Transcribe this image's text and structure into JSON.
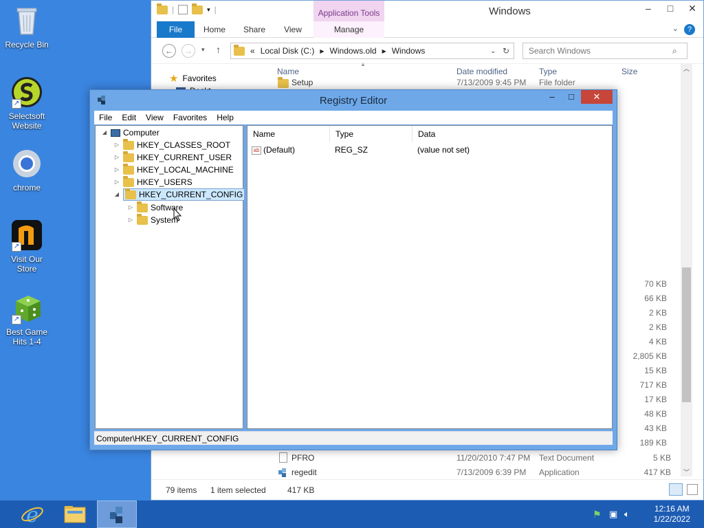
{
  "desktop": {
    "icons": [
      {
        "label": "Recycle Bin"
      },
      {
        "label": "Selectsoft Website"
      },
      {
        "label": "chrome"
      },
      {
        "label": "Visit Our Store"
      },
      {
        "label": "Best Game Hits 1-4"
      }
    ]
  },
  "explorer": {
    "title": "Windows",
    "app_tools_label": "Application Tools",
    "tabs": [
      "File",
      "Home",
      "Share",
      "View",
      "Manage"
    ],
    "address": {
      "prefix": "«",
      "parts": [
        "Local Disk (C:)",
        "Windows.old",
        "Windows"
      ]
    },
    "search_placeholder": "Search Windows",
    "nav_pane": {
      "favorites": "Favorites",
      "partial_item": "Deskt"
    },
    "columns": {
      "name": "Name",
      "date": "Date modified",
      "type": "Type",
      "size": "Size"
    },
    "top_row": {
      "name": "Setup",
      "date": "7/13/2009 9:45 PM",
      "type": "File folder"
    },
    "sizes": [
      "70 KB",
      "66 KB",
      "2 KB",
      "2 KB",
      "4 KB",
      "2,805 KB",
      "15 KB",
      "717 KB",
      "17 KB",
      "48 KB",
      "43 KB",
      "189 KB"
    ],
    "rows": [
      {
        "name": "PFRO",
        "date": "11/20/2010 7:47 PM",
        "type": "Text Document",
        "size": "5 KB"
      },
      {
        "name": "regedit",
        "date": "7/13/2009 6:39 PM",
        "type": "Application",
        "size": "417 KB"
      }
    ],
    "status": {
      "items": "79 items",
      "selected": "1 item selected",
      "size": "417 KB"
    }
  },
  "regedit": {
    "title": "Registry Editor",
    "menu": [
      "File",
      "Edit",
      "View",
      "Favorites",
      "Help"
    ],
    "tree": {
      "root": "Computer",
      "hives": [
        "HKEY_CLASSES_ROOT",
        "HKEY_CURRENT_USER",
        "HKEY_LOCAL_MACHINE",
        "HKEY_USERS",
        "HKEY_CURRENT_CONFIG"
      ],
      "children": [
        "Software",
        "System"
      ]
    },
    "list": {
      "headers": [
        "Name",
        "Type",
        "Data"
      ],
      "rows": [
        {
          "name": "(Default)",
          "type": "REG_SZ",
          "data": "(value not set)"
        }
      ]
    },
    "status": "Computer\\HKEY_CURRENT_CONFIG"
  },
  "taskbar": {
    "clock_time": "12:16 AM",
    "clock_date": "1/22/2022"
  }
}
